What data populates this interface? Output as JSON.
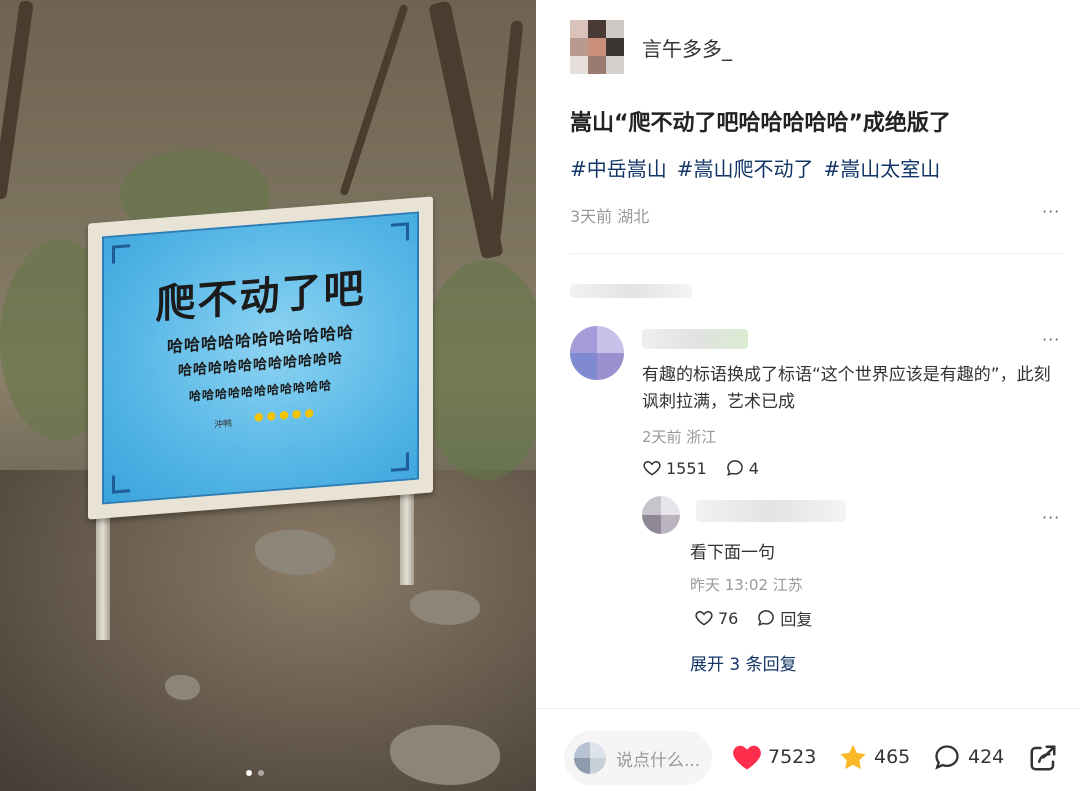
{
  "photo": {
    "sign_title": "爬不动了吧",
    "sign_line1": "哈哈哈哈哈哈哈哈哈哈哈",
    "sign_line2": "哈哈哈哈哈哈哈哈哈哈哈",
    "sign_line3": "哈哈哈哈哈哈哈哈哈哈哈",
    "sign_signature": "沖鸭",
    "sign_chicks": "●●●●●",
    "carousel_total": 2,
    "carousel_active": 1
  },
  "author": {
    "name": "言午多多_"
  },
  "post": {
    "title": "嵩山“爬不动了吧哈哈哈哈哈”成绝版了",
    "tags": [
      "#中岳嵩山",
      "#嵩山爬不动了",
      "#嵩山太室山"
    ],
    "meta": "3天前 湖北",
    "more": "···"
  },
  "comment": {
    "text": "有趣的标语换成了标语“这个世界应该是有趣的”，此刻讽刺拉满，艺术已成",
    "meta": "2天前 浙江",
    "likes": "1551",
    "replies": "4",
    "more": "···"
  },
  "reply": {
    "text": "看下面一句",
    "meta": "昨天 13:02 江苏",
    "likes": "76",
    "reply_label": "回复",
    "more": "···"
  },
  "expand_label": "展开 3 条回复",
  "bottom_bar": {
    "input_placeholder": "说点什么...",
    "likes": "7523",
    "stars": "465",
    "comments": "424"
  },
  "colors": {
    "tag": "#133667",
    "heart": "#ff2e4d",
    "star": "#fbb829",
    "muted": "#999999"
  },
  "icons": [
    "heart-icon",
    "comment-icon",
    "star-icon",
    "share-icon",
    "more-icon"
  ]
}
